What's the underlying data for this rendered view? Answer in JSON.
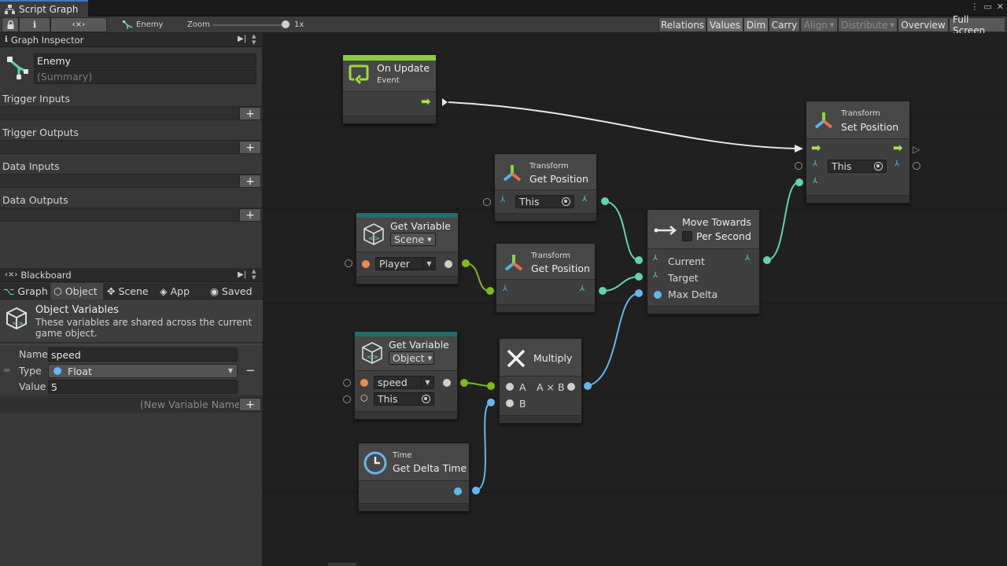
{
  "window": {
    "title": "Script Graph"
  },
  "toolbar": {
    "graph_name": "Enemy",
    "zoom_label": "Zoom",
    "zoom_value": 1,
    "zoom_value_label": "1x",
    "buttons": [
      "Relations",
      "Values",
      "Dim",
      "Carry",
      "Align",
      "Distribute",
      "Overview",
      "Full Screen"
    ]
  },
  "inspector": {
    "title": "Graph Inspector",
    "graph_title": "Enemy",
    "summary_placeholder": "(Summary)",
    "sections": [
      "Trigger Inputs",
      "Trigger Outputs",
      "Data Inputs",
      "Data Outputs"
    ]
  },
  "blackboard": {
    "title": "Blackboard",
    "tabs": [
      "Graph",
      "Object",
      "Scene",
      "App",
      "Saved"
    ],
    "active_tab": "Object",
    "heading": "Object Variables",
    "description": "These variables are shared across the current game object.",
    "variable": {
      "name_label": "Name",
      "name": "speed",
      "type_label": "Type",
      "type": "Float",
      "value_label": "Value",
      "value": "5"
    },
    "new_variable_placeholder": "(New Variable Name)"
  },
  "nodes": {
    "on_update": {
      "title": "On Update",
      "subtitle": "Event"
    },
    "set_position": {
      "category": "Transform",
      "title": "Set Position",
      "target": "This"
    },
    "get_position_1": {
      "category": "Transform",
      "title": "Get Position",
      "target": "This"
    },
    "get_variable_1": {
      "title": "Get Variable",
      "kind": "Scene",
      "variable": "Player"
    },
    "get_position_2": {
      "category": "Transform",
      "title": "Get Position"
    },
    "move_towards": {
      "title": "Move Towards",
      "option": "Per Second",
      "ports": [
        "Current",
        "Target",
        "Max Delta"
      ]
    },
    "get_variable_2": {
      "title": "Get Variable",
      "kind": "Object",
      "variable": "speed",
      "target": "This"
    },
    "multiply": {
      "title": "Multiply",
      "port_a": "A",
      "port_b": "B",
      "output": "A × B"
    },
    "time": {
      "category": "Time",
      "title": "Get Delta Time"
    }
  },
  "colors": {
    "flow": "#a7e34a",
    "vector": "#5fd4a6",
    "float": "#61b8ee",
    "object": "#7fba18",
    "accent": "#3a79bb"
  }
}
